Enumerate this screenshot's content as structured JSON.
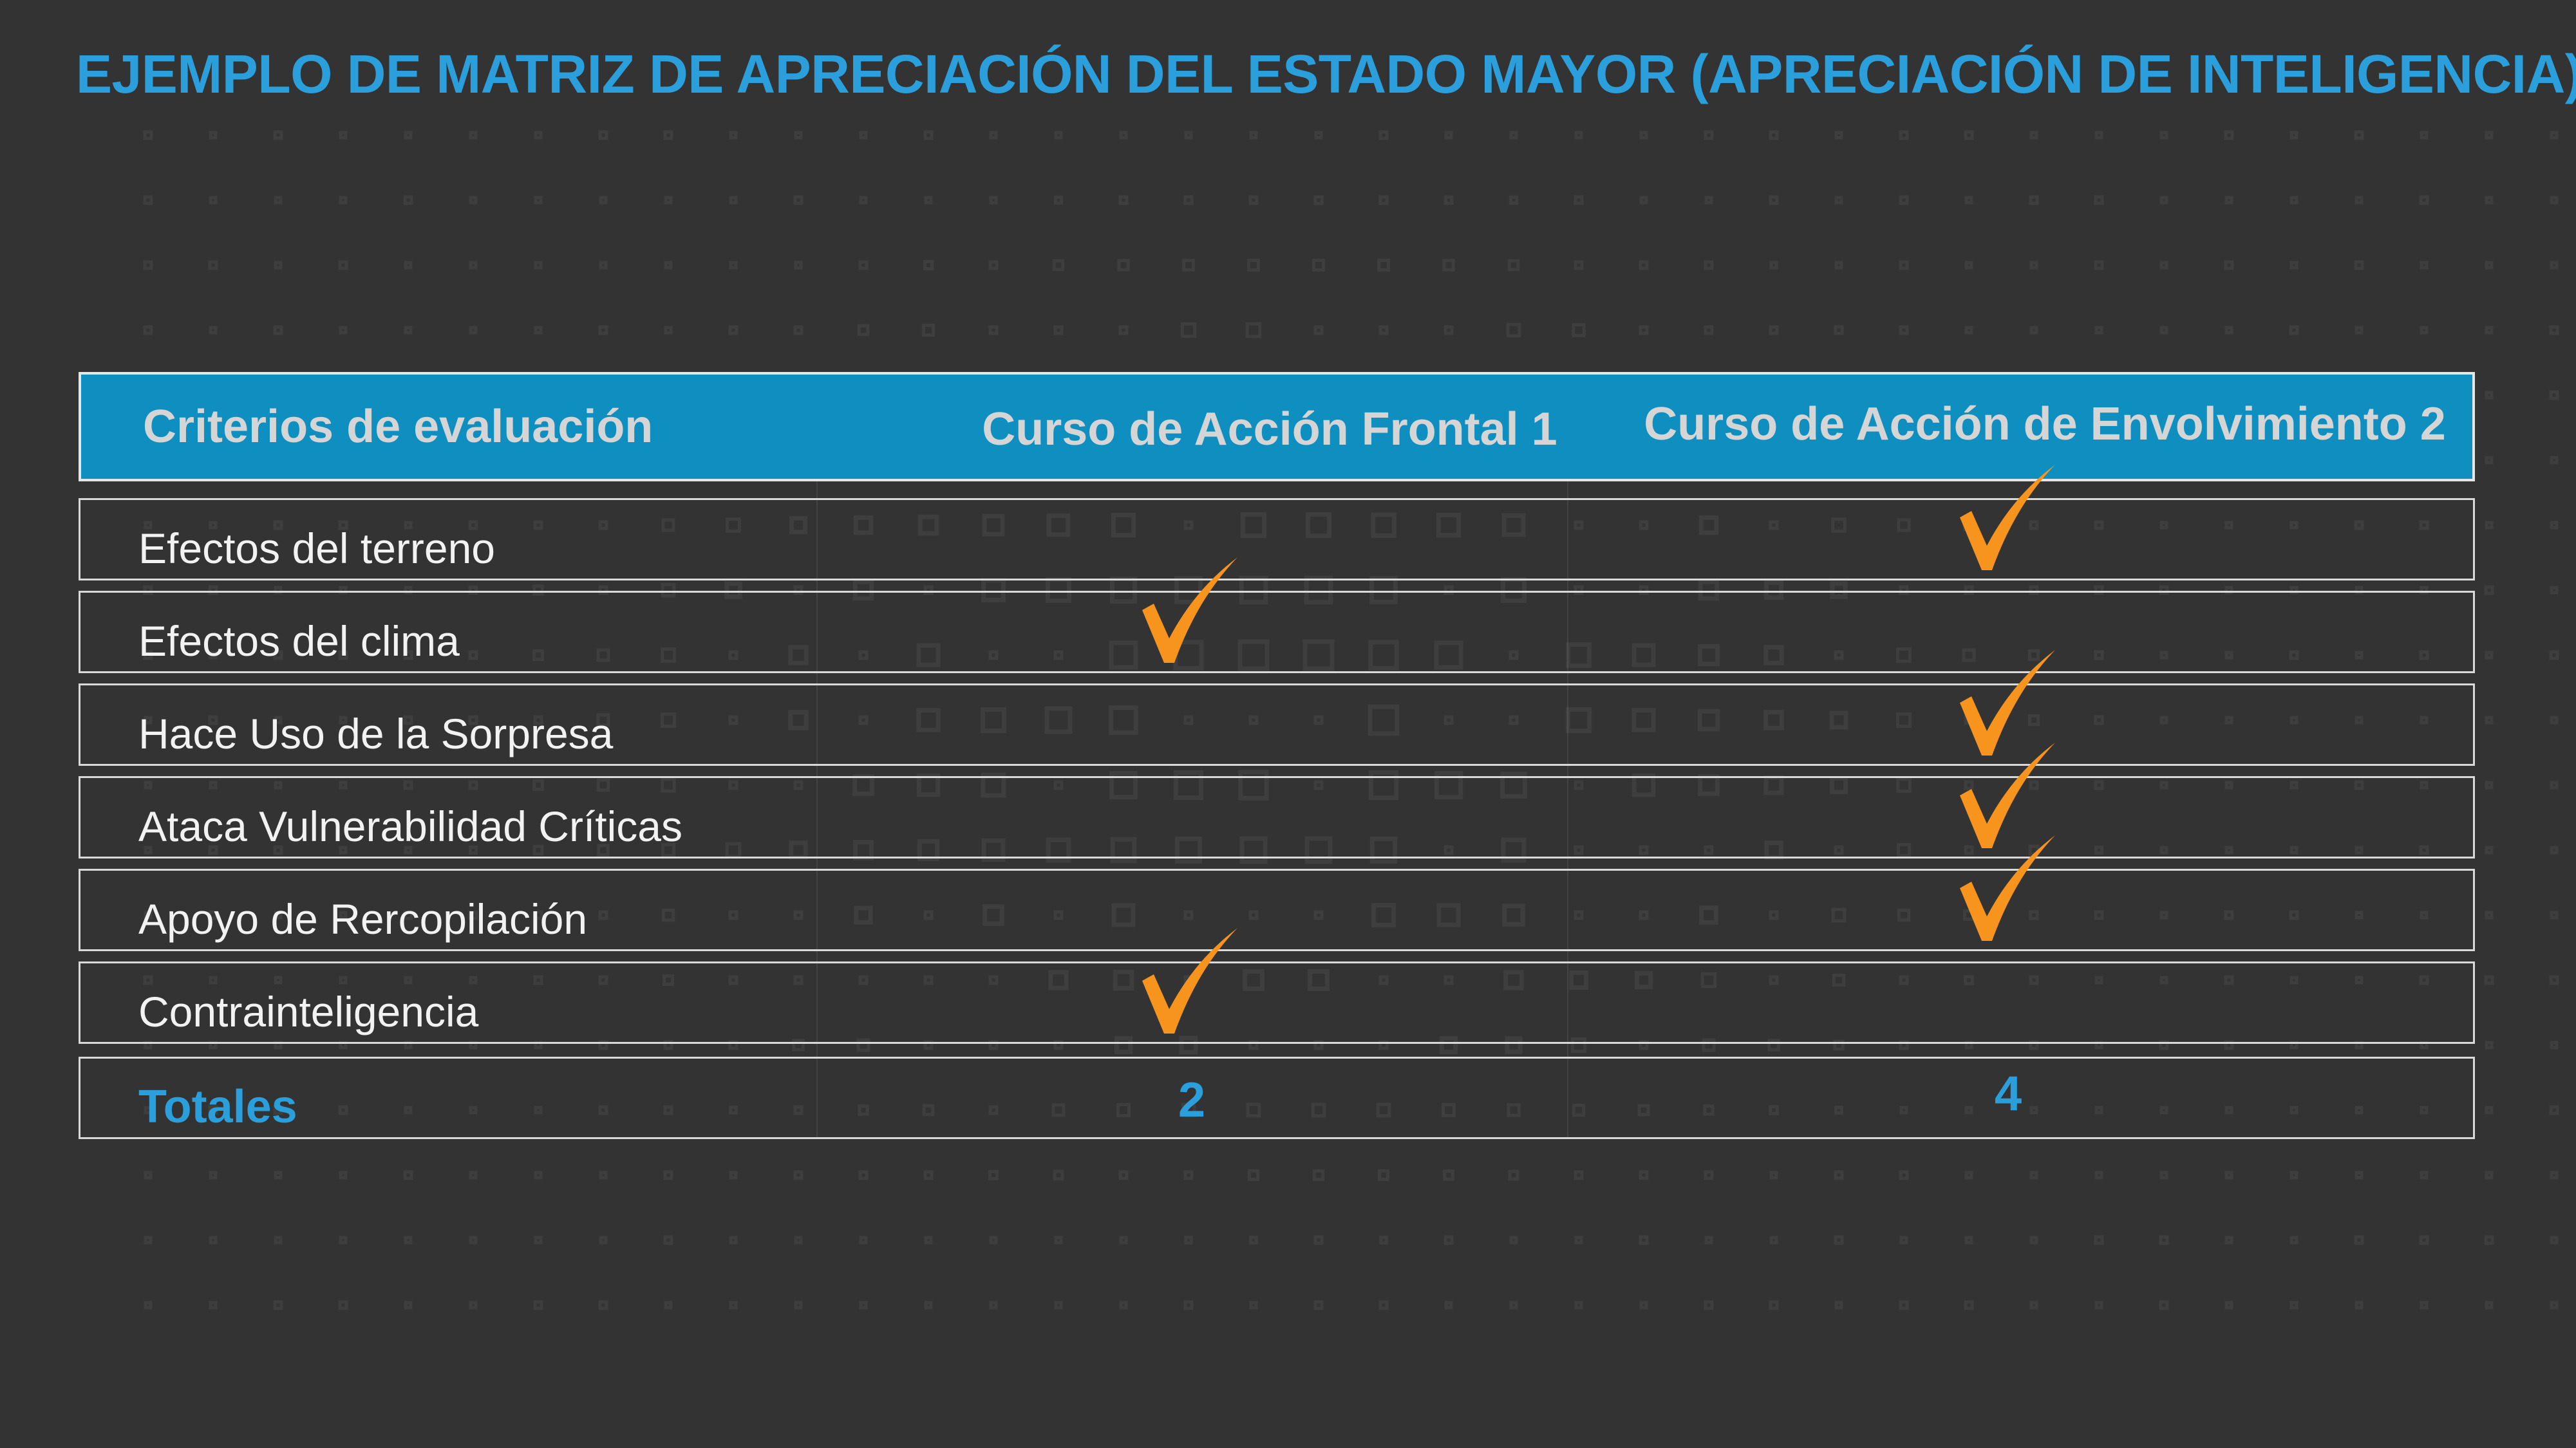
{
  "title": "EJEMPLO DE MATRIZ DE APRECIACIÓN DEL ESTADO MAYOR (APRECIACIÓN DE INTELIGENCIA)",
  "colors": {
    "background": "#333333",
    "accent": "#2a9fdc",
    "header_fill": "#0f8fc0",
    "check": "#f7941d"
  },
  "table": {
    "headers": [
      "Criterios de evaluación",
      "Curso de Acción Frontal 1",
      "Curso de Acción de Envolvimiento 2"
    ],
    "rows": [
      {
        "label": "Efectos del terreno",
        "checks": [
          false,
          true
        ]
      },
      {
        "label": "Efectos del clima",
        "checks": [
          true,
          false
        ]
      },
      {
        "label": "Hace Uso de la Sorpresa",
        "checks": [
          false,
          true
        ]
      },
      {
        "label": "Ataca Vulnerabilidad Críticas",
        "checks": [
          false,
          true
        ]
      },
      {
        "label": "Apoyo de Rercopilación",
        "checks": [
          false,
          true
        ]
      },
      {
        "label": "Contrainteligencia",
        "checks": [
          true,
          false
        ]
      }
    ],
    "totals": {
      "label": "Totales",
      "values": [
        "2",
        "4"
      ]
    }
  }
}
